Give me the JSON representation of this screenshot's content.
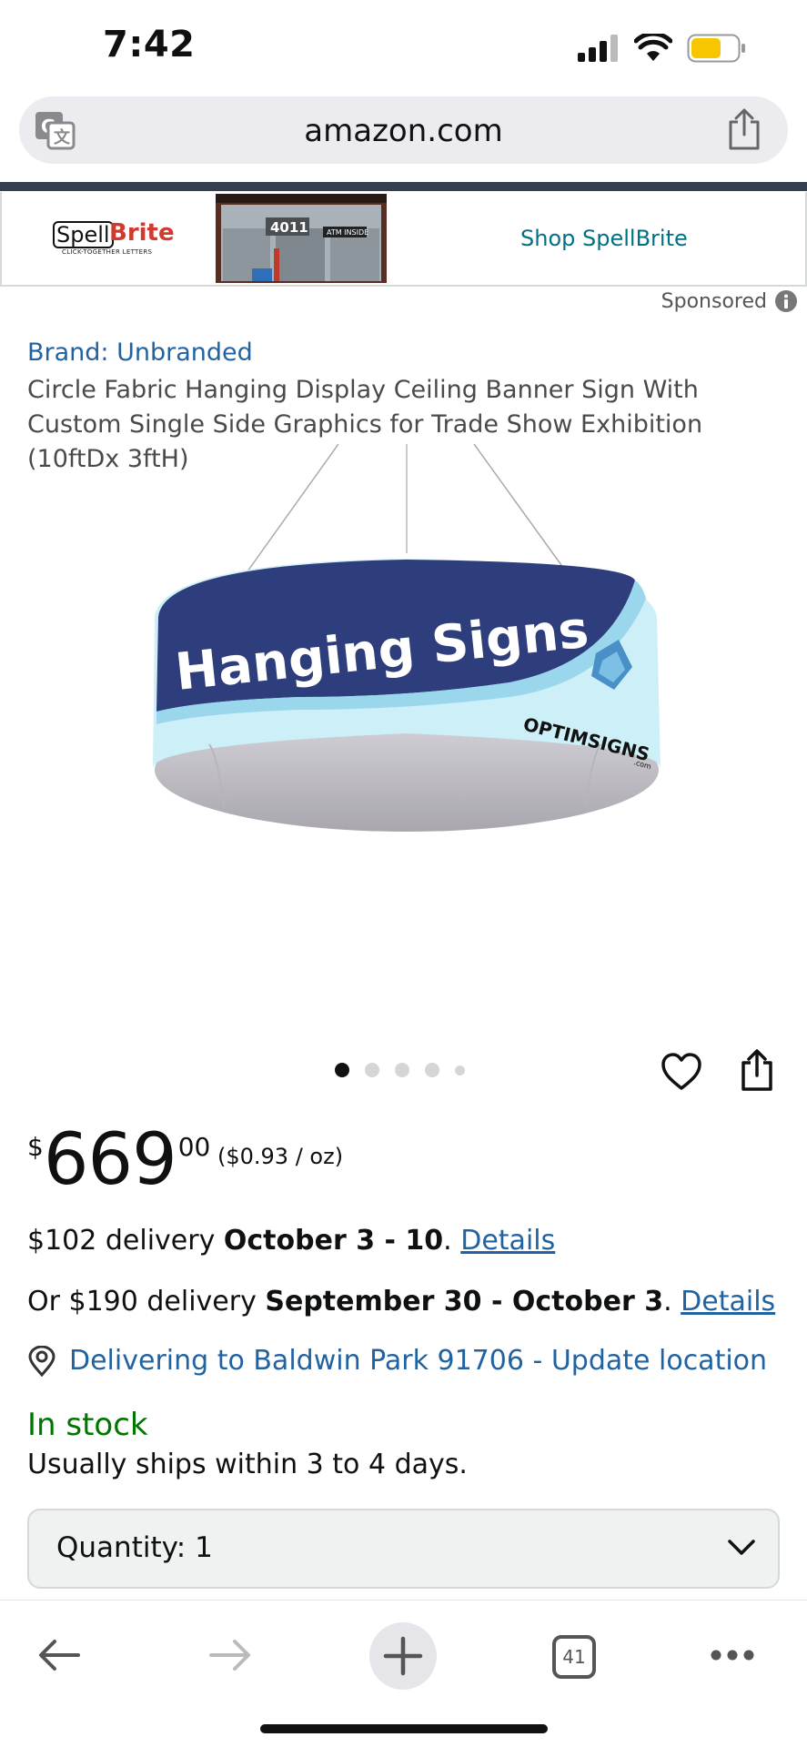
{
  "status_bar": {
    "time": "7:42",
    "icons": [
      "signal-icon",
      "wifi-icon",
      "battery-icon"
    ],
    "battery_color": "#f7c600"
  },
  "browser": {
    "url": "amazon.com",
    "icons": [
      "translate-icon",
      "share-icon"
    ]
  },
  "ad_banner": {
    "logo_text_1": "Spell",
    "logo_text_2": "Brite",
    "logo_tagline": "CLICK-TOGETHER LETTERS",
    "storefront_sign": "4011",
    "storefront_sign_2": "ATM INSIDE",
    "cta": "Shop SpellBrite",
    "sponsored_label": "Sponsored"
  },
  "product": {
    "brand": "Brand: Unbranded",
    "title": "Circle Fabric Hanging Display Ceiling Banner Sign With Custom Single Side Graphics for Trade Show Exhibition (10ftDx 3ftH)",
    "image_text": "Hanging Signs",
    "image_logo": "OPTIMSIGNS",
    "image_logo_suffix": ".com",
    "carousel": {
      "count": 5,
      "active_index": 0
    }
  },
  "price": {
    "symbol": "$",
    "whole": "669",
    "fraction": "00",
    "unit_price": "($0.93 / oz)"
  },
  "delivery": {
    "line1_prefix": "$102 delivery ",
    "line1_date": "October 3 - 10",
    "line1_sep": ". ",
    "line1_link": "Details",
    "line2_prefix": "Or $190 delivery ",
    "line2_date": "September 30 - October 3",
    "line2_sep": ". ",
    "line2_link": "Details",
    "location": "Delivering to Baldwin Park 91706 - Update location"
  },
  "stock": {
    "status": "In stock",
    "note": "Usually ships within 3 to 4 days."
  },
  "quantity": {
    "label": "Quantity:",
    "value": "1"
  },
  "toolbar": {
    "tab_count": "41",
    "icons": [
      "back-arrow-icon",
      "forward-arrow-icon",
      "plus-icon",
      "tabs-icon",
      "more-icon"
    ]
  },
  "colors": {
    "link": "#2162a1",
    "teal_link": "#007185",
    "in_stock": "#007600",
    "header_strip": "#33404f"
  }
}
